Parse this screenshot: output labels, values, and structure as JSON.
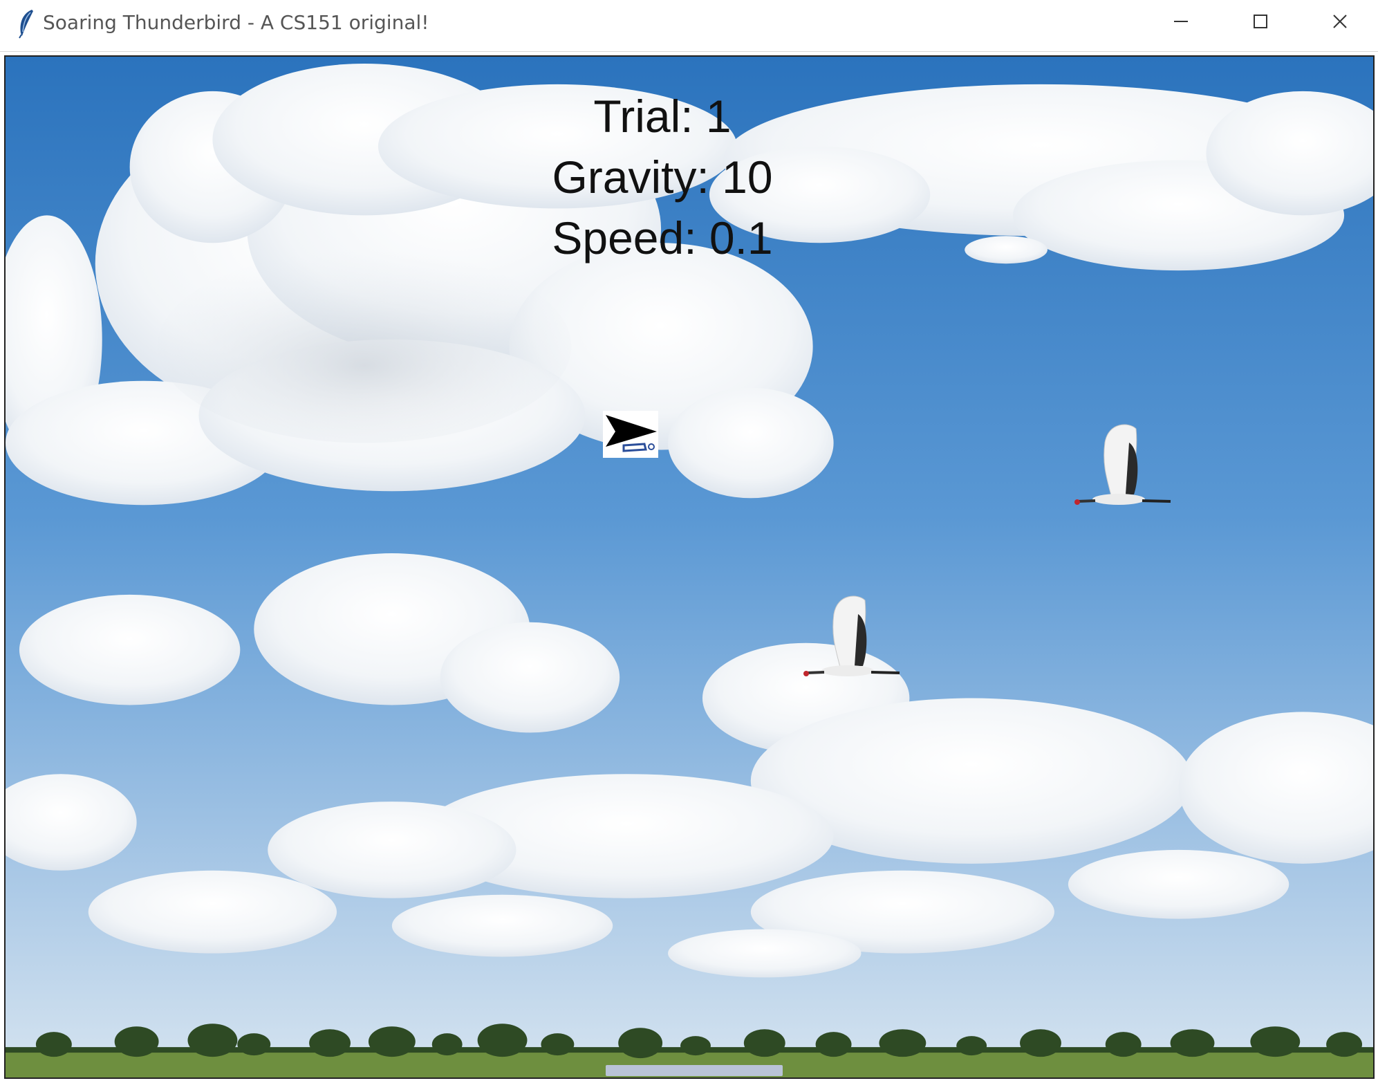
{
  "window": {
    "title": "Soaring Thunderbird - A CS151 original!",
    "icon": "feather-icon",
    "controls": [
      "minimize-icon",
      "maximize-icon",
      "close-icon"
    ]
  },
  "hud": {
    "trial": "Trial: 1",
    "gravity": "Gravity: 10",
    "speed": "Speed: 0.1"
  },
  "scene": {
    "background": "sky-with-clouds",
    "sprites": [
      "hang-glider-player",
      "crane-bird",
      "crane-bird"
    ],
    "colors": {
      "sky_top": "#2f77c0",
      "sky_bottom": "#cfe0ef",
      "grass": "#6a8f3c",
      "trees": "#2f4a22"
    }
  }
}
